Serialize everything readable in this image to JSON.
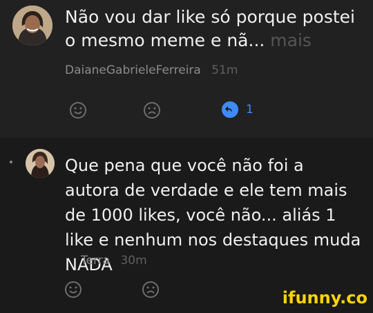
{
  "comments": [
    {
      "text": "Não vou dar like só porque postei o mesmo meme e nã...",
      "more_label": "mais",
      "author": "DaianeGabrieleFerreira",
      "time": "51m",
      "reply_count": "1"
    },
    {
      "text": "Que pena que você não foi a autora de verdade e ele tem mais de 1000 likes, você não... aliás 1 like e nenhum nos destaques muda NADA",
      "author": "Terra",
      "time": "30m"
    }
  ],
  "watermark": "ifunny.co",
  "colors": {
    "reply_blue": "#3d8bff",
    "brand_yellow": "#ffd400"
  }
}
